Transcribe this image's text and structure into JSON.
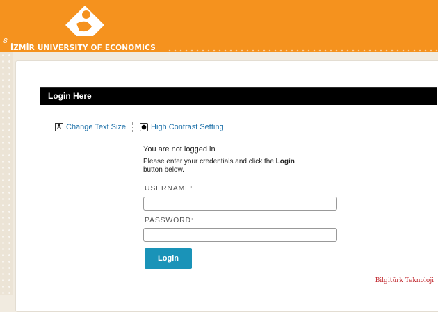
{
  "header": {
    "university_name": "İZMİR UNIVERSITY OF ECONOMICS",
    "corner_glyph": "8",
    "brand_color": "#f5921e"
  },
  "login": {
    "title": "Login Here",
    "accessibility": {
      "text_size_label": "Change Text Size",
      "text_size_icon": "text-size-icon",
      "contrast_label": "High Contrast Setting",
      "contrast_icon": "contrast-icon"
    },
    "status": "You are not logged in",
    "instructions_before": "Please enter your credentials and click the ",
    "instructions_bold": "Login",
    "instructions_after": " button below.",
    "username_label": "USERNAME:",
    "username_value": "",
    "password_label": "PASSWORD:",
    "password_value": "",
    "button_label": "Login",
    "button_color": "#1a93b8"
  },
  "footer": {
    "credit": "Bilgitürk Teknoloji"
  }
}
